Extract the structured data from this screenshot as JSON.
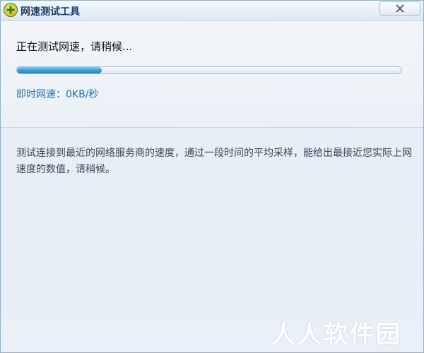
{
  "window": {
    "title": "网速测试工具",
    "app_icon": "green-plus-icon",
    "close_icon": "close-icon"
  },
  "status": {
    "text": "正在测试网速，请稍候...",
    "progress_percent": 22
  },
  "speed": {
    "label": "即时网速：",
    "value": "0KB/秒"
  },
  "description": "测试连接到最近的网络服务商的速度，通过一段时间的平均采样，能给出最接近您实际上网速度的数值，请稍候。",
  "watermark": "人人软件园",
  "colors": {
    "title": "#1e3d6e",
    "speed_text": "#2a6fb8",
    "progress": "#2a9fd8"
  }
}
